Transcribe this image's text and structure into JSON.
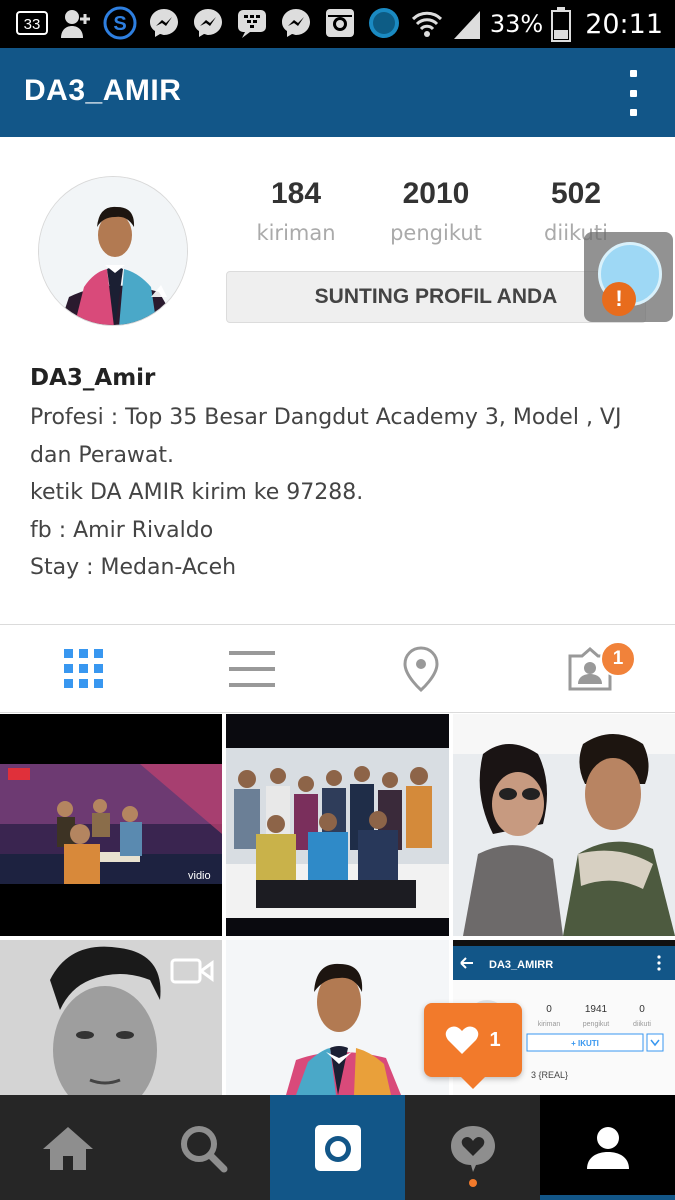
{
  "status_bar": {
    "notification_icons": [
      "sim-33-icon",
      "add-contact-icon",
      "s-app-icon",
      "messenger-icon",
      "messenger-icon",
      "bbm-icon",
      "messenger-icon",
      "instagram-icon",
      "circle-app-icon"
    ],
    "notification_count_label": "33",
    "battery_percent": "33%",
    "time": "20:11"
  },
  "header": {
    "title": "DA3_AMIR",
    "menu_icon": "more-vert-icon"
  },
  "profile": {
    "stats": [
      {
        "value": "184",
        "label": "kiriman"
      },
      {
        "value": "2010",
        "label": "pengikut"
      },
      {
        "value": "502",
        "label": "diikuti"
      }
    ],
    "edit_button": "SUNTING PROFIL ANDA",
    "assist_alert": "!",
    "name": "DA3_Amir",
    "bio_lines": [
      "Profesi : Top 35 Besar Dangdut Academy 3, Model , VJ",
      "dan Perawat.",
      "ketik DA AMIR kirim ke 97288.",
      "fb : Amir Rivaldo",
      "Stay : Medan-Aceh"
    ]
  },
  "tabs": {
    "items": [
      "grid-view-icon",
      "list-view-icon",
      "location-pin-icon",
      "tagged-photos-icon"
    ],
    "tagged_badge": "1",
    "active_color": "#3897f0",
    "inactive_color": "#999999"
  },
  "grid": {
    "tiles": [
      {
        "name": "post-stage-performance",
        "tv_logo": "vidio"
      },
      {
        "name": "post-group-photo"
      },
      {
        "name": "post-selfie-couple"
      },
      {
        "name": "post-bw-selfie-video"
      },
      {
        "name": "post-portrait-floral-jacket"
      },
      {
        "name": "post-profile-screenshot",
        "shot_title": "DA3_AMIRR",
        "shot_stats": [
          {
            "value": "0",
            "label": "kiriman"
          },
          {
            "value": "1941",
            "label": "pengikut"
          },
          {
            "value": "0",
            "label": "diikuti"
          }
        ],
        "shot_button": "+ IKUTI",
        "shot_bio": "3 {REAL}"
      }
    ]
  },
  "toast": {
    "likes": "1"
  },
  "bottom_nav": {
    "items": [
      "home-icon",
      "search-icon",
      "camera-icon",
      "activity-icon",
      "profile-icon"
    ],
    "active": "profile-icon",
    "bar_color": "#262626",
    "accent_color": "#125688"
  },
  "colors": {
    "brand": "#125688",
    "notification": "#f27a2b"
  }
}
